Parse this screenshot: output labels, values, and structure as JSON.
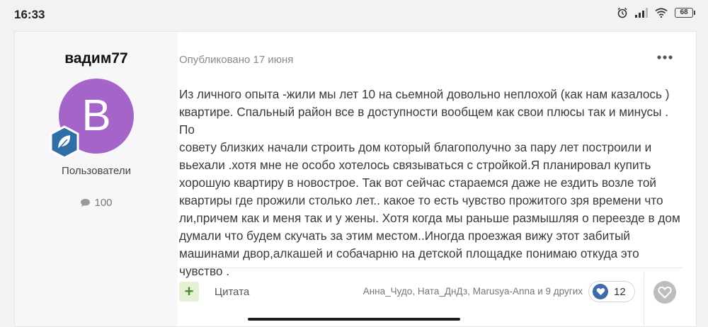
{
  "status_bar": {
    "time": "16:33",
    "icons": [
      "alarm-icon",
      "signal-icon",
      "wifi-icon",
      "battery-icon"
    ],
    "battery_level": "68"
  },
  "author": {
    "name": "вадим77",
    "avatar_letter": "B",
    "avatar_color": "#a564c9",
    "group": "Пользователи",
    "post_count": "100"
  },
  "post": {
    "date": "Опубликовано 17 июня",
    "body_lines": [
      "Из личного опыта -жили мы лет 10 на сьемной довольно неплохой (как нам казалось )",
      "квартире. Спальный район все в доступности вообщем как свои плюсы так и минусы . По",
      "совету близких начали строить дом который благополучно за пару лет построили и",
      "вьехали .хотя мне не особо хотелось связываться с стройкой.Я планировал купить",
      "хорошую квартиру в новострое. Так вот сейчас стараемся даже не ездить возле той",
      "квартиры где прожили столько лет.. какое то есть чувство прожитого зря времени что",
      "ли,причем как и меня так и у жены. Хотя когда мы раньше размышляя о переезде в дом",
      "думали что будем скучать за этим местом..Иногда проезжая вижу этот забитый",
      "машинами двор,алкашей и собачарню на детской площадке понимаю откуда это чувство ."
    ]
  },
  "footer": {
    "quote_label": "Цитата",
    "likers_text": "Анна_Чудо, Ната_ДнДз, Marusya-Anna и 9 других",
    "reaction_count": "12",
    "accent_green": "#4a8c2c",
    "reaction_blue": "#3d6aa8"
  }
}
